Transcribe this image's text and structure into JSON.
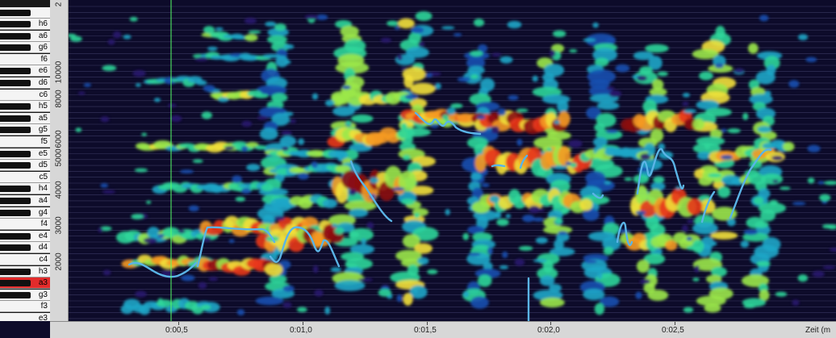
{
  "piano": {
    "notes": [
      "h6",
      "a6",
      "g6",
      "f6",
      "e6",
      "d6",
      "c6",
      "h5",
      "a5",
      "g5",
      "f5",
      "e5",
      "d5",
      "c5",
      "h4",
      "a4",
      "g4",
      "f4",
      "e4",
      "d4",
      "c4",
      "h3",
      "a3",
      "g3",
      "f3",
      "e3"
    ],
    "black_after": [
      "h6",
      "a6",
      "g6",
      "e6",
      "d6",
      "h5",
      "a5",
      "g5",
      "e5",
      "d5",
      "h4",
      "a4",
      "g4",
      "e4",
      "d4",
      "h3",
      "a3",
      "g3"
    ],
    "highlighted": "a3",
    "highlight_color": "#e32b2b"
  },
  "y_axis": {
    "ticks": [
      "2000",
      "3000",
      "4000",
      "5000",
      "6000",
      "8000",
      "10000"
    ],
    "top_label": "2"
  },
  "x_axis": {
    "ticks": [
      "0:00,5",
      "0:01,0",
      "0:01,5",
      "0:02,0",
      "0:02,5"
    ],
    "label": "Zeit (m"
  },
  "playhead": {
    "color": "#55ff66"
  },
  "pitch_color": "#5ab4e6"
}
